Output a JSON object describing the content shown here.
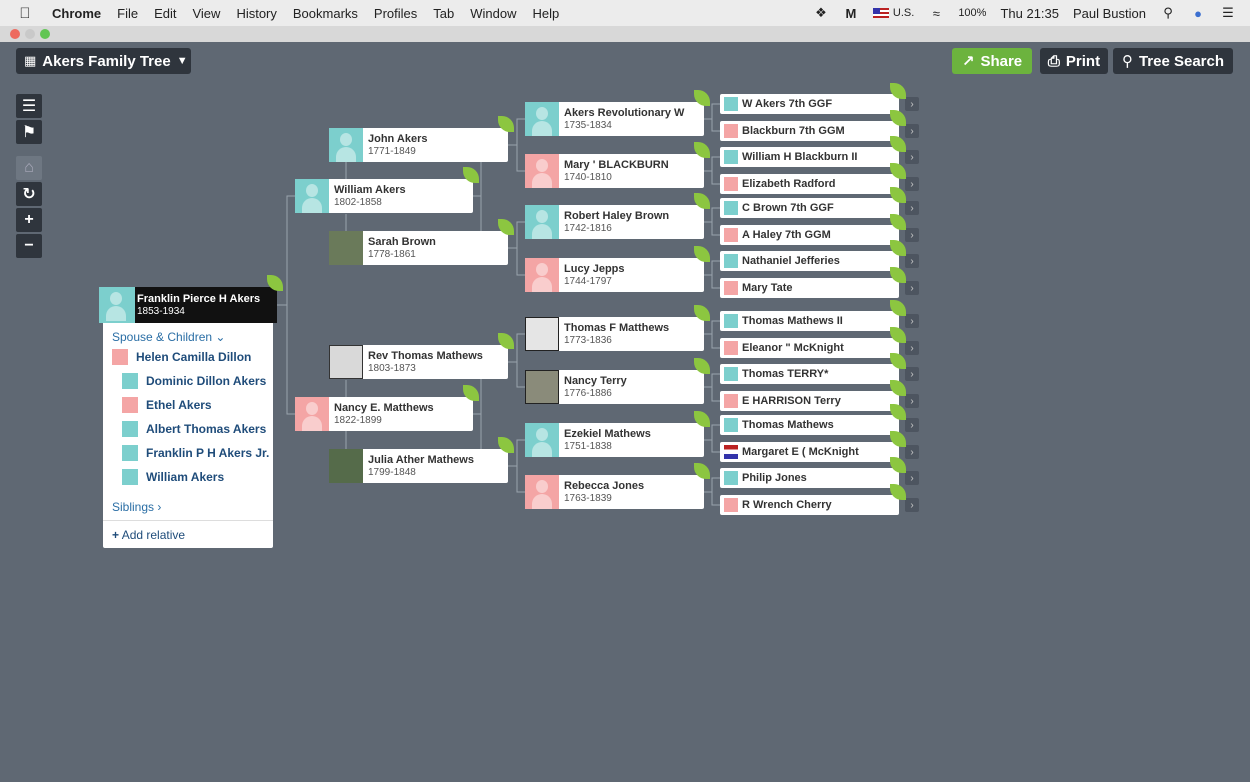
{
  "menubar": {
    "app": "Chrome",
    "items": [
      "File",
      "Edit",
      "View",
      "History",
      "Bookmarks",
      "Profiles",
      "Tab",
      "Window",
      "Help"
    ],
    "locale": "U.S.",
    "battery": "100%",
    "clock": "Thu 21:35",
    "user": "Paul Bustion"
  },
  "toolbar": {
    "tree_name": "Akers Family Tree",
    "share": "Share",
    "print": "Print",
    "tree_search": "Tree Search"
  },
  "focus": {
    "name": "Franklin Pierce H Akers",
    "dates": "1853-1934"
  },
  "family": {
    "header": "Spouse & Children",
    "spouse": "Helen Camilla Dillon",
    "children": [
      {
        "name": "Dominic Dillon Akers",
        "sex": "m"
      },
      {
        "name": "Ethel Akers",
        "sex": "f"
      },
      {
        "name": "Albert Thomas Akers",
        "sex": "m"
      },
      {
        "name": "Franklin P H Akers Jr.",
        "sex": "m"
      },
      {
        "name": "William Akers",
        "sex": "m"
      }
    ],
    "siblings": "Siblings",
    "add_relative": "Add relative"
  },
  "gen1": [
    {
      "name": "William Akers",
      "dates": "1802-1858"
    },
    {
      "name": "Nancy E. Matthews",
      "dates": "1822-1899"
    }
  ],
  "gen2": [
    {
      "name": "John Akers",
      "dates": "1771-1849"
    },
    {
      "name": "Sarah Brown",
      "dates": "1778-1861"
    },
    {
      "name": "Rev Thomas Mathews",
      "dates": "1803-1873"
    },
    {
      "name": "Julia Ather Mathews",
      "dates": "1799-1848"
    }
  ],
  "gen3": [
    {
      "name": "Akers Revolutionary W",
      "dates": "1735-1834"
    },
    {
      "name": "Mary ' BLACKBURN",
      "dates": "1740-1810"
    },
    {
      "name": "Robert Haley Brown",
      "dates": "1742-1816"
    },
    {
      "name": "Lucy Jepps",
      "dates": "1744-1797"
    },
    {
      "name": "Thomas F Matthews",
      "dates": "1773-1836"
    },
    {
      "name": "Nancy Terry",
      "dates": "1776-1886"
    },
    {
      "name": "Ezekiel Mathews",
      "dates": "1751-1838"
    },
    {
      "name": "Rebecca Jones",
      "dates": "1763-1839"
    }
  ],
  "gen4": [
    "W Akers 7th GGF",
    "Blackburn 7th GGM",
    "William H Blackburn II",
    "Elizabeth Radford",
    "C Brown 7th GGF",
    "A Haley 7th GGM",
    "Nathaniel Jefferies",
    "Mary Tate",
    "Thomas Mathews II",
    "Eleanor \" McKnight",
    "Thomas TERRY*",
    "E HARRISON Terry",
    "Thomas Mathews",
    "Margaret E ( McKnight",
    "Philip Jones",
    "R Wrench Cherry"
  ],
  "colors": {
    "bg": "#5f6873",
    "male": "#7ccfcd",
    "female": "#f4a5a5",
    "leaf": "#8cc640",
    "share": "#6cb33e",
    "dark": "#2f353d"
  }
}
